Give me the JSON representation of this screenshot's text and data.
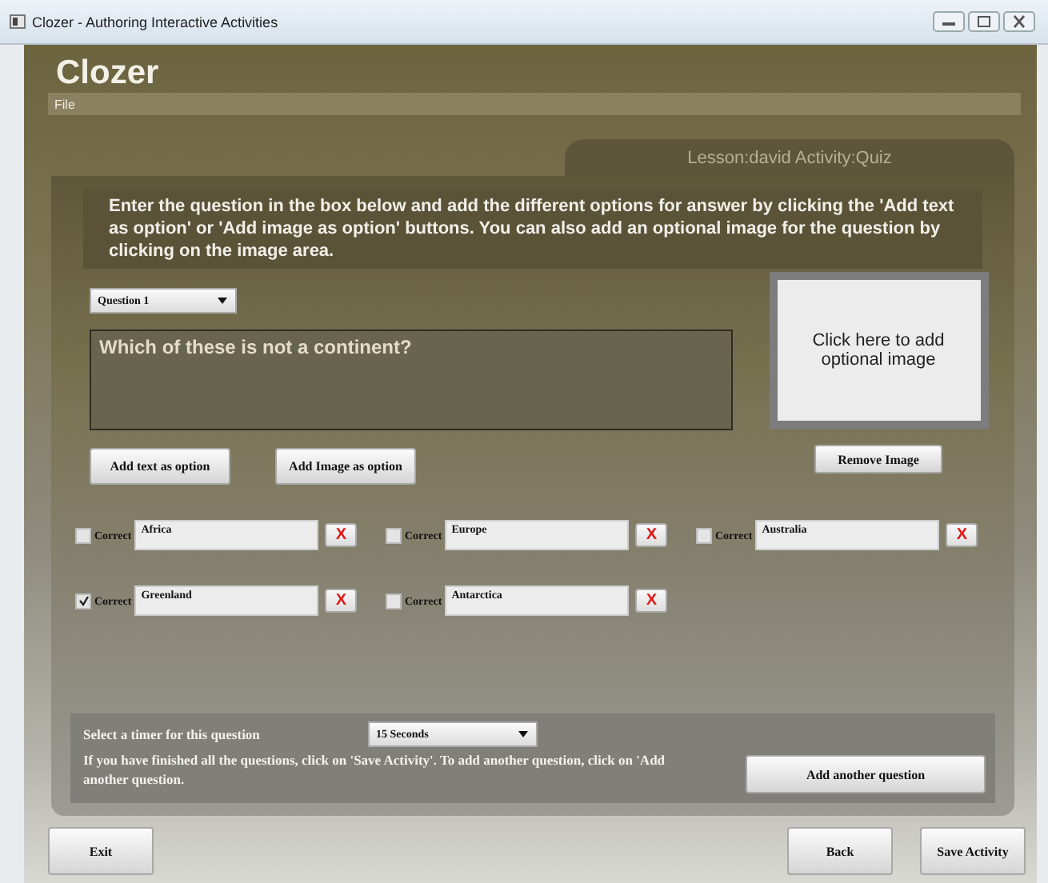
{
  "window": {
    "title": "Clozer - Authoring Interactive Activities"
  },
  "app_title": "Clozer",
  "menu": [
    "File"
  ],
  "tab": {
    "label": "Lesson:david Activity:Quiz"
  },
  "instructions": "Enter the question in the box below and add the different options for answer by clicking the 'Add text as option' or 'Add image as option' buttons. You can also add an optional image for the question by clicking on the image area.",
  "question_select": {
    "value": "Question 1"
  },
  "question": {
    "value": "Which of these is not a continent?"
  },
  "add_buttons": [
    "Add text as option",
    "Add Image as option"
  ],
  "image_area": {
    "text": "Click here to add optional image"
  },
  "remove_image": "Remove Image",
  "options": [
    {
      "label": "Correct",
      "checked": false,
      "value": "Africa",
      "remove": "X"
    },
    {
      "label": "Correct",
      "checked": false,
      "value": "Europe",
      "remove": "X"
    },
    {
      "label": "Correct",
      "checked": false,
      "value": "Australia",
      "remove": "X"
    },
    {
      "label": "Correct",
      "checked": true,
      "value": "Greenland",
      "remove": "X"
    },
    {
      "label": "Correct",
      "checked": false,
      "value": "Antarctica",
      "remove": "X"
    }
  ],
  "timer": {
    "label": "Select a timer for this question",
    "value": "15 Seconds"
  },
  "footer_note": "If you have finished all the questions, click on 'Save Activity'. To add another question, click on 'Add another question.",
  "add_question": "Add another question",
  "bottom_buttons": {
    "left": [
      "Exit"
    ],
    "right": [
      "Back",
      "Save Activity"
    ]
  }
}
